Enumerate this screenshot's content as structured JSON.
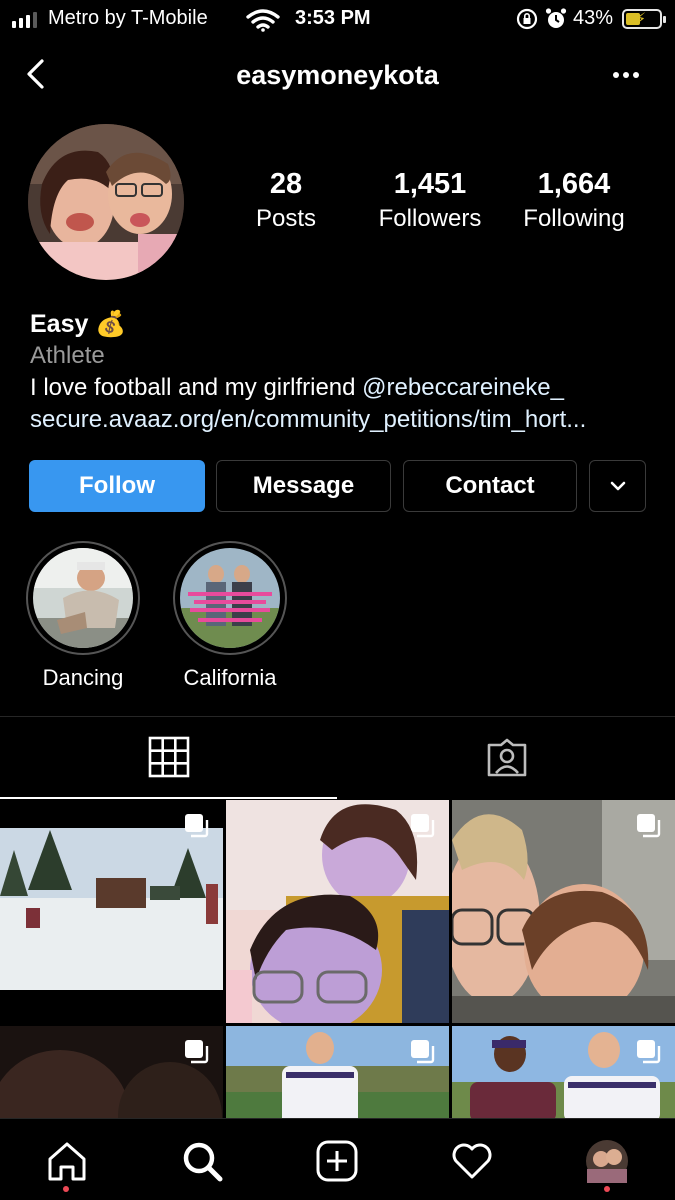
{
  "status_bar": {
    "carrier": "Metro by T-Mobile",
    "time": "3:53 PM",
    "battery": "43%",
    "battery_level": 0.43
  },
  "header": {
    "username": "easymoneykota",
    "back_icon": "chevron-left-icon",
    "more_icon": "ellipsis-icon"
  },
  "profile": {
    "stats": [
      {
        "value": "28",
        "label": "Posts"
      },
      {
        "value": "1,451",
        "label": "Followers"
      },
      {
        "value": "1,664",
        "label": "Following"
      }
    ],
    "name": "Easy 💰",
    "category": "Athlete",
    "bio_text": "I love football and my girlfriend ",
    "bio_mention": "@rebeccareineke_",
    "link": "secure.avaaz.org/en/community_petitions/tim_hort..."
  },
  "actions": {
    "follow": "Follow",
    "message": "Message",
    "contact": "Contact"
  },
  "highlights": [
    {
      "label": "Dancing"
    },
    {
      "label": "California"
    }
  ],
  "colors": {
    "accent": "#3897f0",
    "background": "#000000",
    "notification": "#ed4956",
    "muted": "#9a9a9a"
  }
}
